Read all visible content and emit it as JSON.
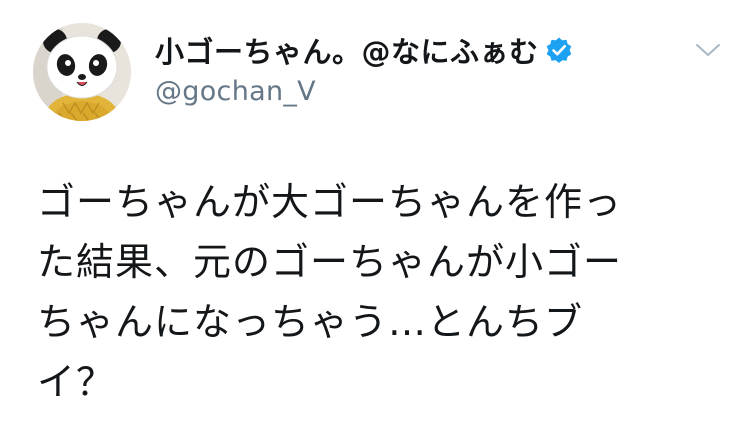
{
  "tweet": {
    "author": {
      "display_name": "小ゴーちゃん。@なにふぁむ",
      "handle": "@gochan_V",
      "verified": true
    },
    "text_lines": [
      "ゴーちゃんが大ゴーちゃんを作っ",
      "た結果、元のゴーちゃんが小ゴー",
      "ちゃんになっちゃう…とんちブ",
      "イ？"
    ]
  },
  "colors": {
    "verified_blue": "#1da1f2",
    "handle_gray": "#657786",
    "text": "#14171a"
  },
  "icons": {
    "verified": "verified-badge-icon",
    "caret": "chevron-down-icon",
    "avatar": "panda-mascot-avatar"
  }
}
